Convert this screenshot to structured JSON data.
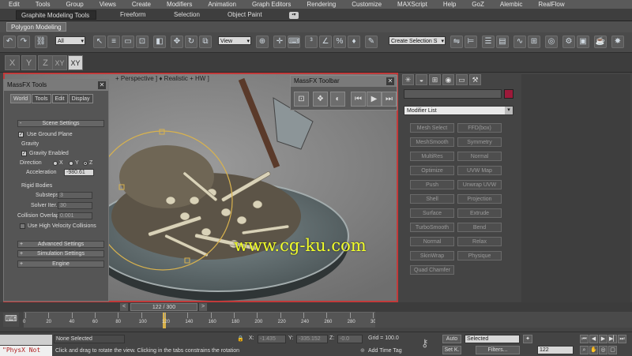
{
  "menu": [
    "Edit",
    "Tools",
    "Group",
    "Views",
    "Create",
    "Modifiers",
    "Animation",
    "Graph Editors",
    "Rendering",
    "Customize",
    "MAXScript",
    "Help",
    "GoZ",
    "Alembic",
    "RealFlow"
  ],
  "ribbon": {
    "tabs": [
      "Graphite Modeling Tools",
      "Freeform",
      "Selection",
      "Object Paint"
    ],
    "subtab": "Polygon Modeling"
  },
  "toolbar": {
    "filter_select": "All",
    "view_select": "View",
    "selection_set_placeholder": "Create Selection S"
  },
  "axis": [
    "X",
    "Y",
    "Z",
    "XY",
    "XY"
  ],
  "viewport": {
    "label": "+ Perspective ] ♦ Realistic + HW ]",
    "watermark": "www.cg-ku.com"
  },
  "massfx_tools": {
    "title": "MassFX Tools",
    "tabs": [
      "World",
      "Tools",
      "Edit",
      "Display"
    ],
    "scene_settings": "Scene Settings",
    "use_ground_plane": "Use Ground Plane",
    "gravity_group": "Gravity",
    "gravity_enabled": "Gravity Enabled",
    "direction_label": "Direction",
    "dir_x": "X",
    "dir_y": "Y",
    "dir_z": "Z",
    "acceleration_label": "Acceleration",
    "acceleration_value": "-980.61",
    "rigid_bodies": "Rigid Bodies",
    "substeps_label": "Substeps",
    "substeps_value": "3",
    "solver_label": "Solver Iter.",
    "solver_value": "30",
    "overlap_label": "Collision Overlap",
    "overlap_value": "0.001",
    "high_velocity": "Use High Velocity Collisions",
    "advanced": "Advanced Settings",
    "simulation": "Simulation Settings",
    "engine": "Engine"
  },
  "massfx_toolbar": {
    "title": "MassFX Toolbar"
  },
  "command_panel": {
    "modifier_list": "Modifier List",
    "accent_color": "#9c1a3a",
    "buttons": [
      [
        "Mesh Select",
        "FFD(box)"
      ],
      [
        "MeshSmooth",
        "Symmetry"
      ],
      [
        "MultiRes",
        "Normal"
      ],
      [
        "Optimize",
        "UVW Map"
      ],
      [
        "Push",
        "Unwrap UVW"
      ],
      [
        "Shell",
        "Projection"
      ],
      [
        "Surface",
        "Extrude"
      ],
      [
        "TurboSmooth",
        "Bend"
      ],
      [
        "Normal",
        "Relax"
      ],
      [
        "SkinWrap",
        "Physique"
      ],
      [
        "Quad Chamfer",
        ""
      ]
    ]
  },
  "timeline": {
    "slider": "122 / 300",
    "ticks": [
      "0",
      "20",
      "40",
      "60",
      "80",
      "100",
      "120",
      "140",
      "160",
      "180",
      "200",
      "220",
      "240",
      "260",
      "280",
      "300"
    ]
  },
  "status": {
    "maxscript": "\"PhysX Not",
    "selection": "None Selected",
    "prompt": "Click and drag to rotate the view.  Clicking in the tabs constrains the rotation",
    "x_label": "X:",
    "x_value": "-1.435",
    "y_label": "Y:",
    "y_value": "-335.152",
    "z_label": "Z:",
    "z_value": "-0.0",
    "grid": "Grid = 100.0",
    "add_time_tag": "Add Time Tag",
    "auto": "Auto",
    "setk": "Set K.",
    "selected": "Selected",
    "filters": "Filters...",
    "frame": "122"
  }
}
